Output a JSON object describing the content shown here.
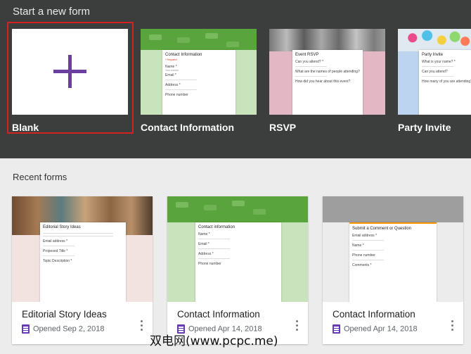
{
  "start_section": {
    "title": "Start a new form",
    "templates": [
      {
        "label": "Blank"
      },
      {
        "label": "Contact Information",
        "form_title": "Contact Information",
        "required_note": "* Required",
        "fields": [
          "Name *",
          "Email *",
          "Address *",
          "Phone number"
        ],
        "placeholder": "Your answer"
      },
      {
        "label": "RSVP",
        "form_title": "Event RSVP",
        "fields": [
          "Can you attend? *",
          "What are the names of people attending?",
          "How did you hear about this event?"
        ]
      },
      {
        "label": "Party Invite",
        "form_title": "Party Invite",
        "fields": [
          "What is your name? *",
          "Can you attend?",
          "How many of you are attending?"
        ]
      }
    ]
  },
  "recent_section": {
    "title": "Recent forms",
    "forms": [
      {
        "title": "Editorial Story Ideas",
        "opened": "Opened  Sep 2, 2018",
        "form_title": "Editorial Story Ideas",
        "fields": [
          "Email address *",
          "Proposed Title *",
          "Topic Description *"
        ]
      },
      {
        "title": "Contact Information",
        "opened": "Opened  Apr 14, 2018",
        "form_title": "Contact information",
        "fields": [
          "Name *",
          "Email *",
          "Address *",
          "Phone number"
        ]
      },
      {
        "title": "Contact Information",
        "opened": "Opened  Apr 14, 2018",
        "form_title": "Submit a Comment or Question",
        "fields": [
          "Email address *",
          "Name *",
          "Phone number",
          "Comments *"
        ]
      }
    ]
  },
  "watermark": "双电网(www.pcpc.me)",
  "colors": {
    "header_bg": "#3c3e3d",
    "accent_purple": "#673ab7",
    "selection_red": "#d32222",
    "green_theme": "#5aa43e"
  }
}
